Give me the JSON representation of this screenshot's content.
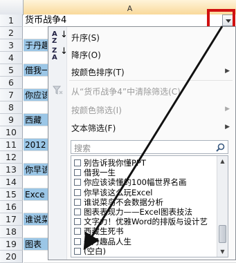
{
  "sheet": {
    "column_label": "A",
    "rows": [
      {
        "num": "1",
        "text": "货币战争4"
      },
      {
        "num": "2",
        "text": ""
      },
      {
        "num": "3",
        "text": "于丹趣"
      },
      {
        "num": "4",
        "text": ""
      },
      {
        "num": "5",
        "text": "借我一"
      },
      {
        "num": "6",
        "text": ""
      },
      {
        "num": "7",
        "text": "你应该"
      },
      {
        "num": "8",
        "text": ""
      },
      {
        "num": "9",
        "text": "西藏"
      },
      {
        "num": "10",
        "text": ""
      },
      {
        "num": "11",
        "text": "2012"
      },
      {
        "num": "12",
        "text": ""
      },
      {
        "num": "13",
        "text": "你早该"
      },
      {
        "num": "14",
        "text": ""
      },
      {
        "num": "15",
        "text": "Exce"
      },
      {
        "num": "16",
        "text": ""
      },
      {
        "num": "17",
        "text": "谁说菜"
      },
      {
        "num": "18",
        "text": ""
      },
      {
        "num": "19",
        "text": "图表"
      },
      {
        "num": "20",
        "text": ""
      }
    ]
  },
  "menu": {
    "sort_asc": "升序(S)",
    "sort_desc": "降序(O)",
    "sort_by_color": "按颜色排序(T)",
    "clear_filter": "从“货币战争4”中清除筛选(C)",
    "filter_by_color": "按颜色筛选(I)",
    "text_filter": "文本筛选(F)",
    "search_placeholder": "搜索",
    "list_items": [
      "别告诉我你懂PPT",
      "借我一生",
      "你应该读懂的100幅世界名画",
      "你早该这么玩Excel",
      "谁说菜鸟不会数据分析",
      "图表表现力——Excel图表技法",
      "文字力！优雅Word的排版与设计艺",
      "西藏生死书",
      "于丹趣品人生",
      "(空白)"
    ]
  },
  "colors": {
    "highlight_red": "#d01010",
    "shaded_cell": "#9bc6e6"
  }
}
